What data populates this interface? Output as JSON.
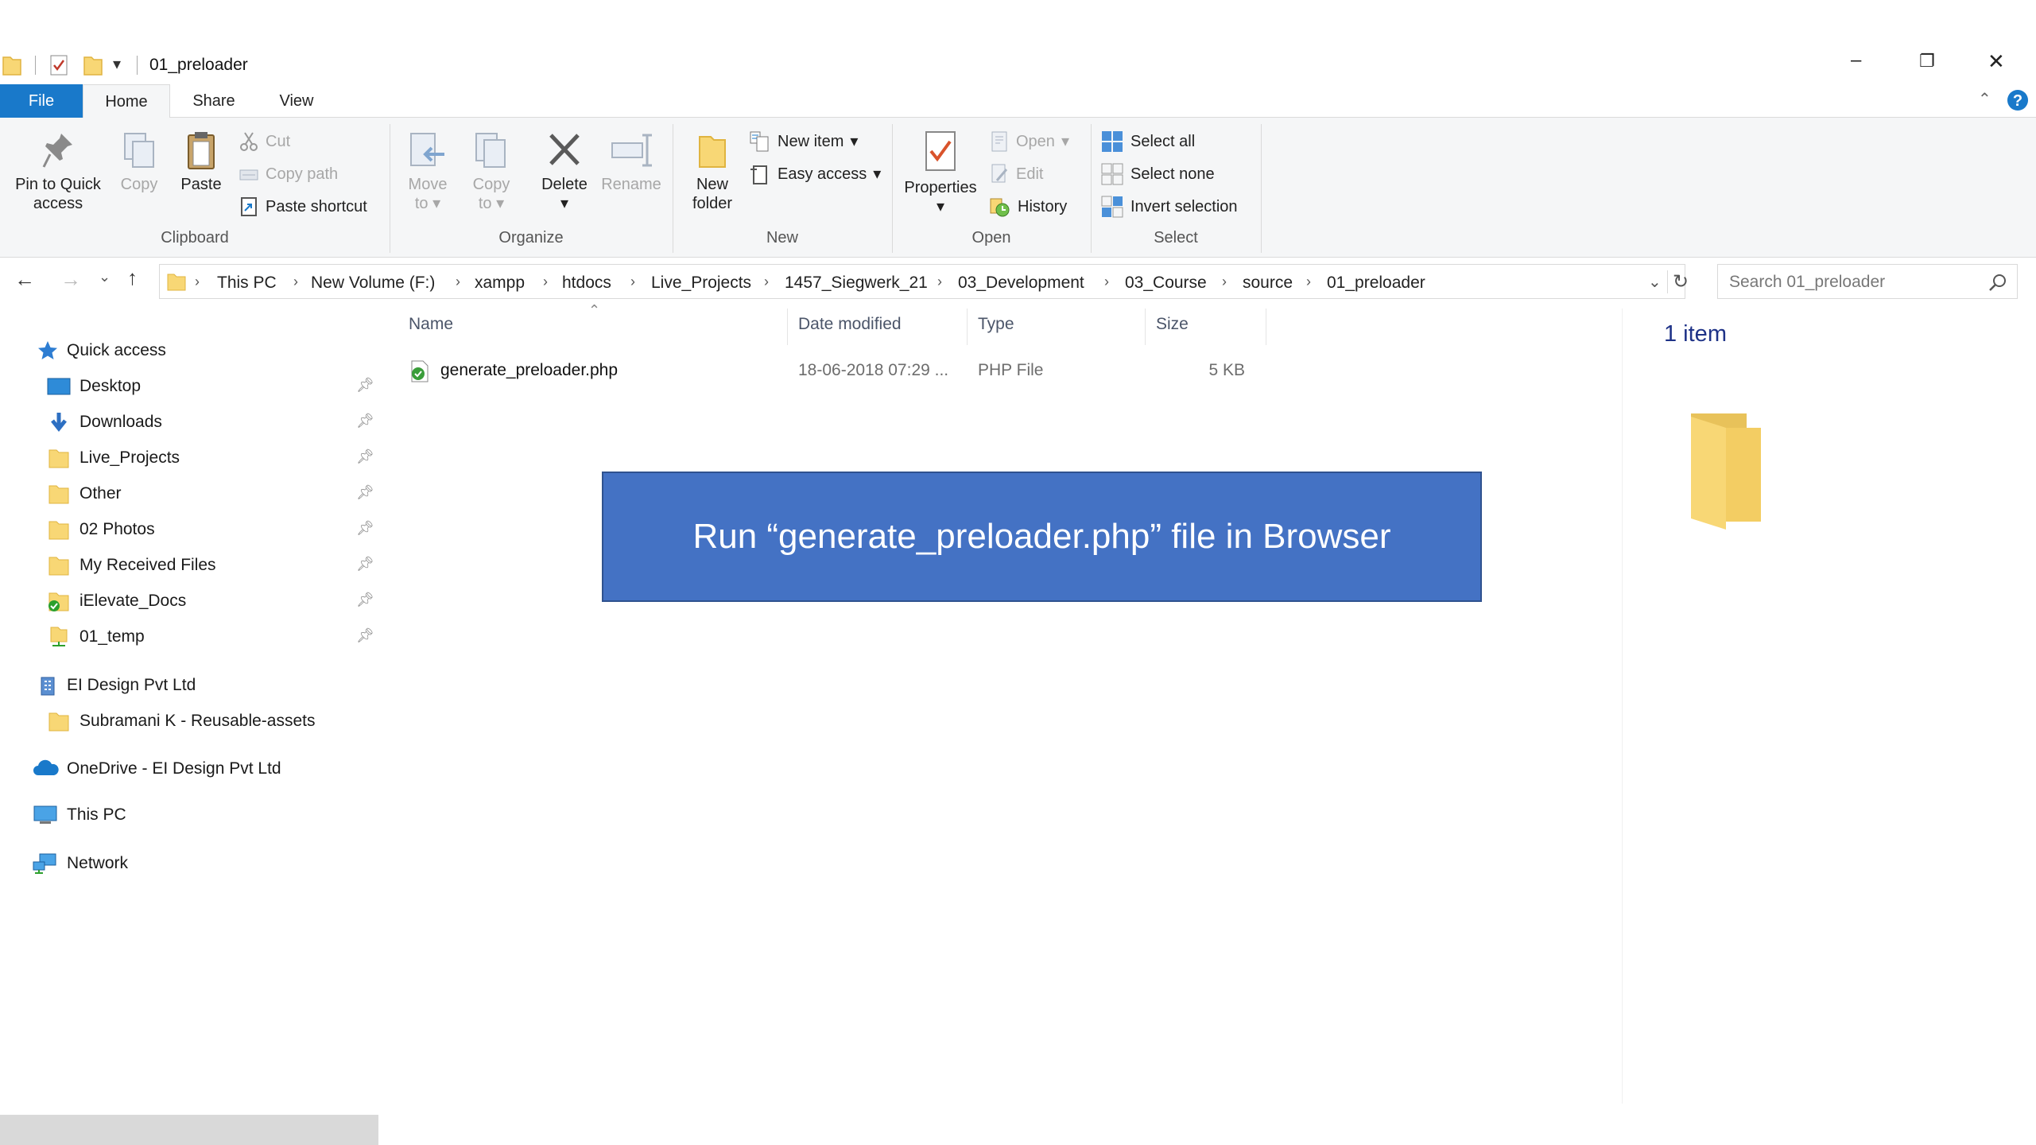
{
  "window": {
    "title": "01_preloader",
    "controls": {
      "minimize": "–",
      "restore": "❐",
      "close": "✕"
    }
  },
  "tabs": [
    {
      "label": "File"
    },
    {
      "label": "Home"
    },
    {
      "label": "Share"
    },
    {
      "label": "View"
    }
  ],
  "ribbon": {
    "clipboard": {
      "label": "Clipboard",
      "pin": "Pin to Quick access",
      "pin_line1": "Pin to Quick",
      "pin_line2": "access",
      "copy": "Copy",
      "paste": "Paste",
      "cut": "Cut",
      "copy_path": "Copy path",
      "paste_shortcut": "Paste shortcut"
    },
    "organize": {
      "label": "Organize",
      "move_line1": "Move",
      "move_line2": "to",
      "copy_line1": "Copy",
      "copy_line2": "to",
      "delete": "Delete",
      "rename": "Rename"
    },
    "new": {
      "label": "New",
      "folder_line1": "New",
      "folder_line2": "folder",
      "new_item": "New item",
      "easy_access": "Easy access"
    },
    "open": {
      "label": "Open",
      "properties": "Properties",
      "open": "Open",
      "edit": "Edit",
      "history": "History"
    },
    "select": {
      "label": "Select",
      "select_all": "Select all",
      "select_none": "Select none",
      "invert": "Invert selection"
    }
  },
  "address": {
    "crumbs": [
      "This PC",
      "New Volume (F:)",
      "xampp",
      "htdocs",
      "Live_Projects",
      "1457_Siegwerk_21",
      "03_Development",
      "03_Course",
      "source",
      "01_preloader"
    ],
    "search_placeholder": "Search 01_preloader"
  },
  "nav": {
    "quick_access": "Quick access",
    "quick_items": [
      "Desktop",
      "Downloads",
      "Live_Projects",
      "Other",
      "02 Photos",
      "My Received Files",
      "iElevate_Docs",
      "01_temp"
    ],
    "org": "EI Design Pvt Ltd",
    "org_item": "Subramani K - Reusable-assets",
    "onedrive": "OneDrive - EI Design Pvt Ltd",
    "this_pc": "This PC",
    "network": "Network"
  },
  "columns": [
    "Name",
    "Date modified",
    "Type",
    "Size"
  ],
  "files": [
    {
      "name": "generate_preloader.php",
      "date": "18-06-2018 07:29 ...",
      "type": "PHP File",
      "size": "5 KB"
    }
  ],
  "status": {
    "count": "1 item"
  },
  "callout": "Run “generate_preloader.php” file in Browser",
  "colors": {
    "file_tab": "#1979ca",
    "callout_bg": "#4472c4",
    "folder": "#f8d775",
    "selection": "#d9d9d9"
  }
}
